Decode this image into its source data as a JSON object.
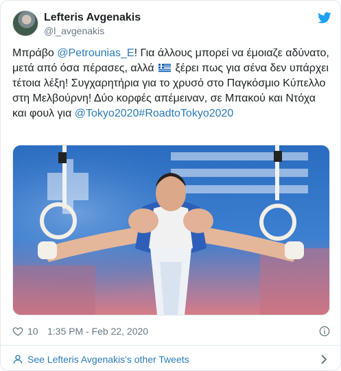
{
  "user": {
    "display_name": "Lefteris Avgenakis",
    "handle": "@l_avgenakis"
  },
  "tweet": {
    "text_before_mention": "Μπράβο ",
    "mention": "@Petrounias_E",
    "text_before_flag": "! Για άλλους μπορεί να έμοιαζε αδύνατο, μετά από όσα πέρασες, αλλά ",
    "flag_icon": "greece-flag-emoji",
    "text_after_flag": " ξέρει πως για σένα δεν υπάρχει τέτοια λέξη! Συγχαρητήρια για το χρυσό στο Παγκόσμιο Κύπελλο στη Μελβούρνη! Δύο κορφές απέμειναν, σε Μπακού και Ντόχα και φουλ για ",
    "hashtag_1": "@Tokyo2020",
    "hashtag_2": "#RoadtoTokyo2020"
  },
  "media": {
    "description_icon": "gymnast-on-rings-photo"
  },
  "meta": {
    "likes": "10",
    "timestamp": "1:35 PM - Feb 22, 2020"
  },
  "footer": {
    "link_label": "See Lefteris Avgenakis's other Tweets"
  },
  "colors": {
    "link": "#2b7bb9",
    "muted": "#697882",
    "twitter_blue": "#1da1f2",
    "border": "#e1e8ed"
  }
}
